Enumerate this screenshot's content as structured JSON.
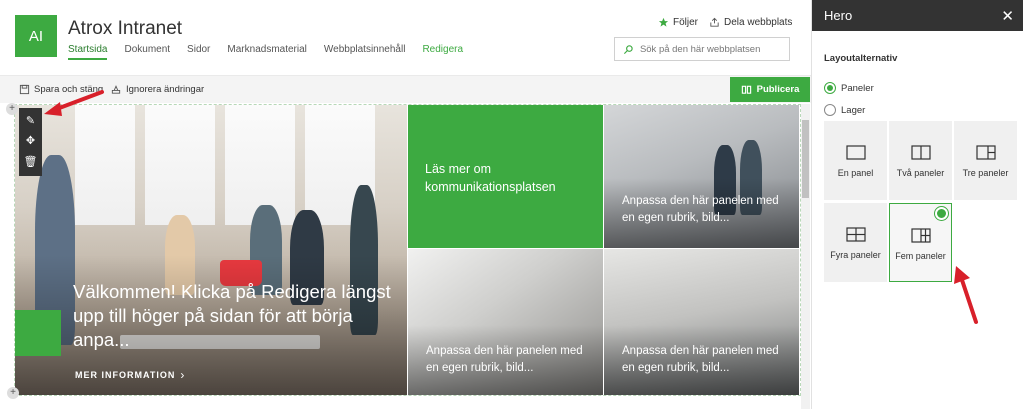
{
  "header": {
    "logo_text": "AI",
    "site_title": "Atrox Intranet",
    "nav": [
      "Startsida",
      "Dokument",
      "Sidor",
      "Marknadsmaterial",
      "Webbplatsinnehåll",
      "Redigera"
    ],
    "follow_label": "Följer",
    "share_label": "Dela webbplats",
    "search_placeholder": "Sök på den här webbplatsen"
  },
  "commandbar": {
    "save_close": "Spara och stäng",
    "discard": "Ignorera ändringar",
    "publish": "Publicera"
  },
  "hero": {
    "main_title": "Välkommen! Klicka på Redigera längst upp till höger på sidan för att börja anpa...",
    "main_more": "MER INFORMATION",
    "green_tile_text": "Läs mer om kommunikationsplatsen",
    "tile_text": "Anpassa den här panelen med en egen rubrik, bild..."
  },
  "panel": {
    "title": "Hero",
    "section_label": "Layoutalternativ",
    "radio_options": [
      "Paneler",
      "Lager"
    ],
    "selected_radio": "Paneler",
    "layout_options": [
      "En panel",
      "Två paneler",
      "Tre paneler",
      "Fyra paneler",
      "Fem paneler"
    ],
    "selected_layout": "Fem paneler"
  },
  "colors": {
    "accent": "#3daa41",
    "panel_header": "#333333"
  }
}
